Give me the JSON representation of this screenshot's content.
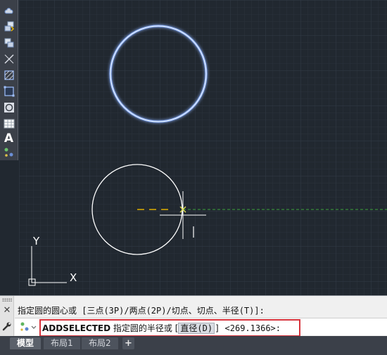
{
  "toolbar": {
    "tools": [
      {
        "icon": "revcloud-icon"
      },
      {
        "icon": "insert-block-icon"
      },
      {
        "icon": "make-block-icon"
      },
      {
        "icon": "line-icon"
      },
      {
        "icon": "hatch-icon"
      },
      {
        "icon": "region-icon"
      },
      {
        "icon": "circle-icon"
      },
      {
        "icon": "table-icon"
      },
      {
        "icon": "text-icon",
        "glyph": "A"
      },
      {
        "icon": "add-selected-icon"
      }
    ]
  },
  "canvas": {
    "background": "#212830",
    "ucs": {
      "x_label": "X",
      "y_label": "Y"
    },
    "colors": {
      "selected_circle": "#8fb4ff",
      "circle": "#ffffff",
      "tracking_line": "#3da53d",
      "snap_line": "#e0b000"
    }
  },
  "command": {
    "history_line": "指定圆的圆心或 [三点(3P)/两点(2P)/切点、切点、半径(T)]:",
    "keyword": "ADDSELECTED",
    "prompt_text": "指定圆的半径或 [",
    "option_label": "直径",
    "option_key": "(D)",
    "prompt_tail": "] <269.1366>:",
    "highlight_color": "#d7333c"
  },
  "tabs": [
    {
      "label": "模型",
      "active": true
    },
    {
      "label": "布局1",
      "active": false
    },
    {
      "label": "布局2",
      "active": false
    }
  ],
  "tab_add_label": "+"
}
